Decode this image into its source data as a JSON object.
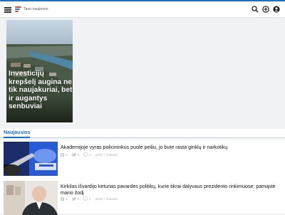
{
  "header": {
    "logo_text": "Tavo naujienos",
    "colors": {
      "accent": "#1f6fc0"
    },
    "icons": [
      "menu-icon",
      "search-icon",
      "add-icon",
      "user-icon"
    ]
  },
  "hero": {
    "title": "Investicijų krepšelį augina ne tik naujakuriai, bet ir augantys senbuviai"
  },
  "section": {
    "tab_label": "Naujausios"
  },
  "articles": [
    {
      "title": "Akademijoje vyras policininkus puolė peiliu, jo bute rasta ginklų ir narkotikų",
      "likes": "0",
      "shares": "0",
      "comments": "0",
      "time": "prieš 7 minutes"
    },
    {
      "title": "Kirkilas išvardijo keturias pavardes politikų, kurie tikrai dalyvaus prezidento rinkimuose: pamąstė mano žodį",
      "likes": "0",
      "shares": "0",
      "comments": "0",
      "time": "prieš 7 minutes"
    }
  ]
}
